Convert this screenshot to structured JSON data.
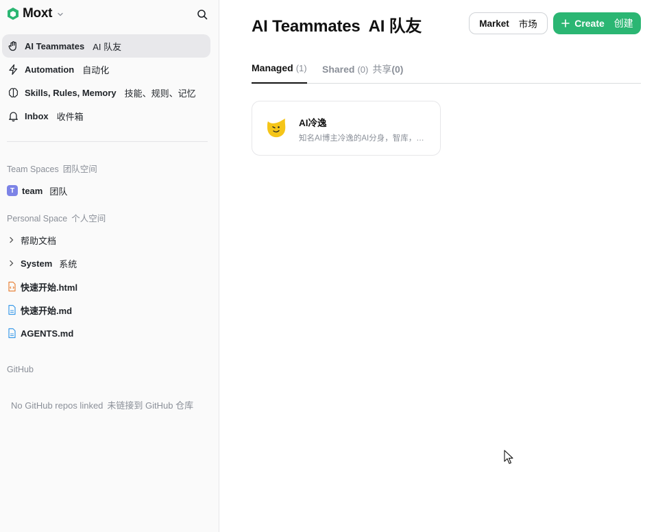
{
  "brand": {
    "name": "Moxt",
    "color": "#2bb673"
  },
  "nav": [
    {
      "label": "AI Teammates",
      "label_zh": "AI 队友",
      "icon": "robot-hand-icon",
      "active": true
    },
    {
      "label": "Automation",
      "label_zh": "自动化",
      "icon": "lightning-icon"
    },
    {
      "label": "Skills, Rules, Memory",
      "label_zh": "技能、规则、记忆",
      "icon": "brain-icon"
    },
    {
      "label": "Inbox",
      "label_zh": "收件箱",
      "icon": "bell-icon"
    }
  ],
  "team_spaces": {
    "label": "Team Spaces",
    "label_zh": "团队空间",
    "badge": "T",
    "team": "team",
    "team_zh": "团队"
  },
  "personal_space": {
    "label": "Personal Space",
    "label_zh": "个人空间",
    "items": [
      {
        "label": "帮助文档",
        "label_zh": "",
        "type": "folder"
      },
      {
        "label": "System",
        "label_zh": "系统",
        "type": "folder"
      },
      {
        "label": "快速开始.html",
        "type": "html-file"
      },
      {
        "label": "快速开始.md",
        "type": "md-file"
      },
      {
        "label": "AGENTS.md",
        "type": "md-file"
      }
    ]
  },
  "github": {
    "label": "GitHub",
    "empty": "No GitHub repos linked",
    "empty_zh": "未链接到 GitHub 仓库"
  },
  "main": {
    "title": "AI Teammates",
    "title_zh": "AI 队友",
    "market_label": "Market",
    "market_zh": "市场",
    "create_label": "Create",
    "create_zh": "创建",
    "tabs": [
      {
        "label": "Managed",
        "count": "(1)"
      },
      {
        "label": "Shared",
        "count": "(0)",
        "label_zh": "共享",
        "count_zh": "(0)"
      }
    ],
    "cards": [
      {
        "name": "AI冷逸",
        "desc": "知名AI博主冷逸的AI分身，智库，…",
        "avatar_color": "#f5c518"
      }
    ]
  }
}
